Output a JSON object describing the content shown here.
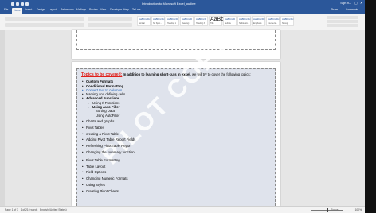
{
  "titlebar": {
    "title": "Introduction to Microsoft Excel_outline",
    "user": "Sign in",
    "min": "–",
    "max": "▢",
    "close": "✕"
  },
  "tabs": [
    {
      "label": "File"
    },
    {
      "label": "Home"
    },
    {
      "label": "Insert"
    },
    {
      "label": "Design"
    },
    {
      "label": "Layout"
    },
    {
      "label": "References"
    },
    {
      "label": "Mailings"
    },
    {
      "label": "Review"
    },
    {
      "label": "View"
    },
    {
      "label": "Developer"
    },
    {
      "label": "Help"
    },
    {
      "label": "Tell me"
    }
  ],
  "share": "Share",
  "comments": "Comments",
  "styles": [
    {
      "sample": "AaBbCcDc",
      "name": "Normal"
    },
    {
      "sample": "AaBbCcDc",
      "name": "No Spac..."
    },
    {
      "sample": "AaBbCcD",
      "name": "Heading 1"
    },
    {
      "sample": "AaBbCcD",
      "name": "Heading 2"
    },
    {
      "sample": "AaBbCcD",
      "name": "Heading 3"
    },
    {
      "sample": "AaBb",
      "name": "Title"
    },
    {
      "sample": "AaBbCcD",
      "name": "Subtitle"
    },
    {
      "sample": "AaBbCcDc",
      "name": "Subtle Em..."
    },
    {
      "sample": "AaBbCcDc",
      "name": "Emphasis"
    },
    {
      "sample": "AaBbCcDc",
      "name": "Intense E..."
    },
    {
      "sample": "AaBbCcDc",
      "name": "Strong"
    }
  ],
  "document": {
    "lead": "Topics to be covered:",
    "lead_bold": "In addition to learning short-cuts in excel,",
    "lead_rest": "we will try to cover the following topics:",
    "topics": [
      {
        "text": "Custom Formats",
        "level": 1,
        "bold": true
      },
      {
        "text": "Conditional Formatting",
        "level": 1,
        "bold": true
      },
      {
        "text": "Convert text to columns",
        "level": 1,
        "blue": true
      },
      {
        "text": "Naming and defining cells",
        "level": 1
      },
      {
        "text": "Advanced Functions",
        "level": 1,
        "bold": true
      },
      {
        "text": "Using If Functions",
        "level": 2
      },
      {
        "text": "Using Auto Filter",
        "level": 2,
        "bold": true
      },
      {
        "text": "Sorting Data",
        "level": 3
      },
      {
        "text": "Using AutoFilter",
        "level": 3
      }
    ],
    "topics2": [
      "Charts and graphs",
      "Pivot Tables",
      "creating a Pivot Table",
      "Adding Pivot Table Report Fields",
      "Refreshing Pivot Table Report",
      "Changing the summary function"
    ],
    "topics3": [
      "Pivot Table Formatting",
      "Table Layout",
      "Field Options",
      "Changing Numeric Formats",
      "Using Styles",
      "Creating Pivot Charts"
    ],
    "watermark": "PILOT COPY"
  },
  "statusbar": {
    "page": "Page 1 of 3",
    "words": "1 of 210 words",
    "language": "English (United States)",
    "focus": "Focus",
    "zoom": "100%"
  }
}
